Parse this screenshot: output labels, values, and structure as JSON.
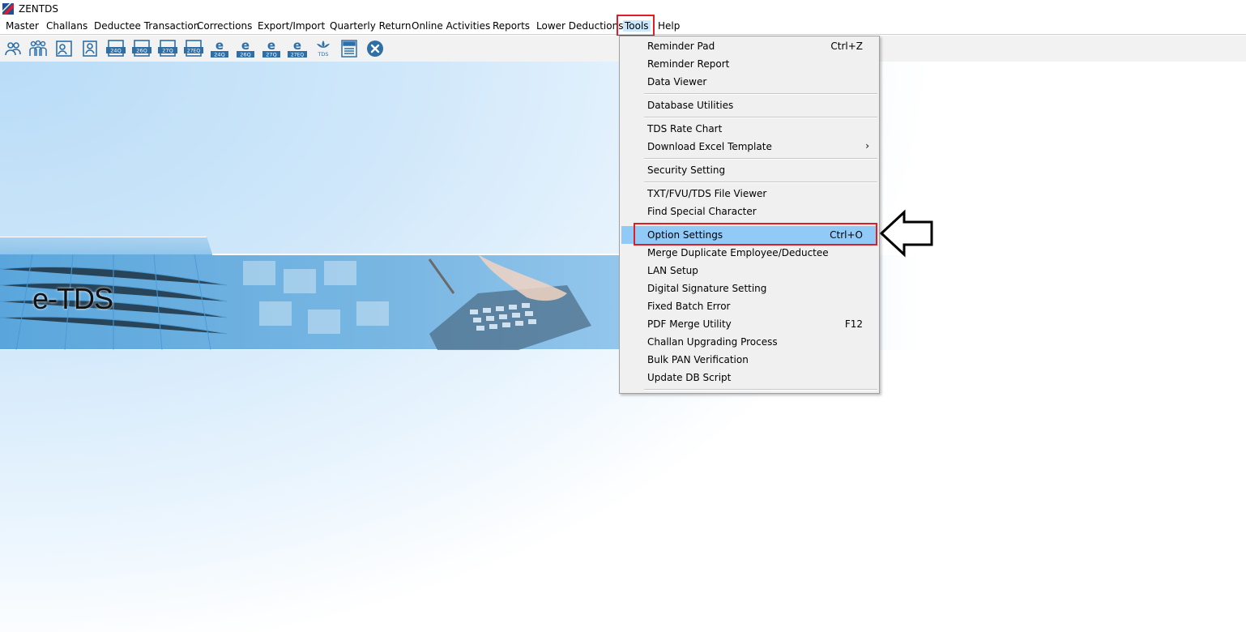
{
  "app": {
    "title": "ZENTDS"
  },
  "menubar": {
    "items": [
      {
        "label": "Master"
      },
      {
        "label": "Challans"
      },
      {
        "label": "Deductee Transaction"
      },
      {
        "label": "Corrections"
      },
      {
        "label": "Export/Import"
      },
      {
        "label": "Quarterly Return"
      },
      {
        "label": "Online Activities"
      },
      {
        "label": "Reports"
      },
      {
        "label": "Lower Deductions"
      },
      {
        "label": "Tools"
      },
      {
        "label": "Help"
      }
    ]
  },
  "toolbar": {
    "labels": [
      "24Q",
      "26Q",
      "27Q",
      "27EQ",
      "24Q",
      "26Q",
      "27Q",
      "27EQ",
      "TDS"
    ]
  },
  "banner": {
    "title": "e-TDS"
  },
  "tools_menu": {
    "items": [
      {
        "label": "Reminder Pad",
        "shortcut": "Ctrl+Z"
      },
      {
        "label": "Reminder Report",
        "shortcut": ""
      },
      {
        "label": "Data Viewer",
        "shortcut": ""
      },
      {
        "label": "Database Utilities",
        "shortcut": ""
      },
      {
        "label": "TDS Rate Chart",
        "shortcut": ""
      },
      {
        "label": "Download Excel Template",
        "shortcut": ""
      },
      {
        "label": "Security Setting",
        "shortcut": ""
      },
      {
        "label": "TXT/FVU/TDS File Viewer",
        "shortcut": ""
      },
      {
        "label": "Find Special Character",
        "shortcut": ""
      },
      {
        "label": "Option Settings",
        "shortcut": "Ctrl+O"
      },
      {
        "label": "Merge Duplicate Employee/Deductee",
        "shortcut": ""
      },
      {
        "label": "LAN Setup",
        "shortcut": ""
      },
      {
        "label": "Digital Signature Setting",
        "shortcut": ""
      },
      {
        "label": "Fixed Batch Error",
        "shortcut": ""
      },
      {
        "label": "PDF Merge Utility",
        "shortcut": "F12"
      },
      {
        "label": "Challan Upgrading Process",
        "shortcut": ""
      },
      {
        "label": "Bulk PAN Verification",
        "shortcut": ""
      },
      {
        "label": "Update DB Script",
        "shortcut": ""
      }
    ]
  },
  "colors": {
    "highlight_border": "#e01c24",
    "menu_selected": "#91c9f7",
    "toolbar_icon": "#2e6fa7"
  }
}
